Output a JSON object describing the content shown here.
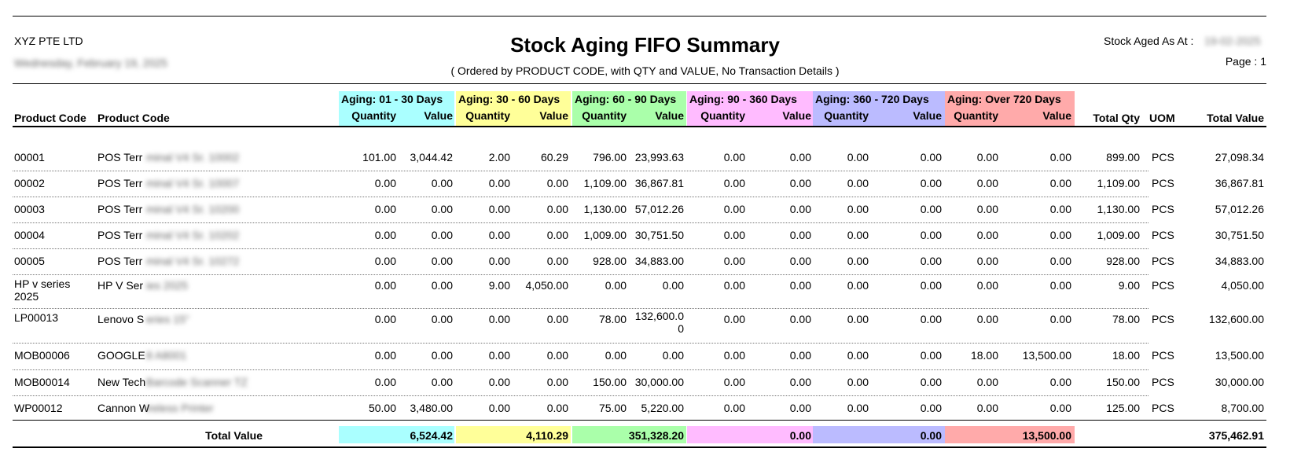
{
  "header": {
    "company": "XYZ PTE LTD",
    "date_line": "Wednesday, February 19, 2025",
    "title": "Stock Aging FIFO Summary",
    "subtitle": "( Ordered by PRODUCT CODE, with QTY and VALUE, No Transaction Details )",
    "aged_label": "Stock Aged As At :",
    "aged_value": "19-02-2025",
    "page": "Page : 1"
  },
  "columns": {
    "product_code": "Product Code",
    "product_name": "Product Code",
    "quantity": "Quantity",
    "value": "Value",
    "total_qty": "Total Qty",
    "uom": "UOM",
    "total_value": "Total Value"
  },
  "aging_bands": [
    {
      "label": "Aging:  01 - 30 Days",
      "color": "#aaffff"
    },
    {
      "label": "Aging:  30 - 60 Days",
      "color": "#ffff99"
    },
    {
      "label": "Aging:  60 - 90 Days",
      "color": "#aaffaa"
    },
    {
      "label": "Aging:  90 - 360 Days",
      "color": "#ffbbff"
    },
    {
      "label": "Aging:  360 - 720 Days",
      "color": "#bbbbff"
    },
    {
      "label": "Aging:  Over 720 Days",
      "color": "#ffaaaa"
    }
  ],
  "rows": [
    {
      "code": "00001",
      "name_visible": "POS Terr",
      "name_hidden": "minal V4 Sr. 10002",
      "vals": [
        "101.00",
        "3,044.42",
        "2.00",
        "60.29",
        "796.00",
        "23,993.63",
        "0.00",
        "0.00",
        "0.00",
        "0.00",
        "0.00",
        "0.00"
      ],
      "total_qty": "899.00",
      "uom": "PCS",
      "total_value": "27,098.34"
    },
    {
      "code": "00002",
      "name_visible": "POS Terr",
      "name_hidden": "minal V4 Sr. 10007",
      "vals": [
        "0.00",
        "0.00",
        "0.00",
        "0.00",
        "1,109.00",
        "36,867.81",
        "0.00",
        "0.00",
        "0.00",
        "0.00",
        "0.00",
        "0.00"
      ],
      "total_qty": "1,109.00",
      "uom": "PCS",
      "total_value": "36,867.81"
    },
    {
      "code": "00003",
      "name_visible": "POS Terr",
      "name_hidden": "minal V4 Sr. 10200",
      "vals": [
        "0.00",
        "0.00",
        "0.00",
        "0.00",
        "1,130.00",
        "57,012.26",
        "0.00",
        "0.00",
        "0.00",
        "0.00",
        "0.00",
        "0.00"
      ],
      "total_qty": "1,130.00",
      "uom": "PCS",
      "total_value": "57,012.26"
    },
    {
      "code": "00004",
      "name_visible": "POS Terr",
      "name_hidden": "minal V4 Sr. 10202",
      "vals": [
        "0.00",
        "0.00",
        "0.00",
        "0.00",
        "1,009.00",
        "30,751.50",
        "0.00",
        "0.00",
        "0.00",
        "0.00",
        "0.00",
        "0.00"
      ],
      "total_qty": "1,009.00",
      "uom": "PCS",
      "total_value": "30,751.50"
    },
    {
      "code": "00005",
      "name_visible": "POS Terr",
      "name_hidden": "minal V4 Sr. 10272",
      "vals": [
        "0.00",
        "0.00",
        "0.00",
        "0.00",
        "928.00",
        "34,883.00",
        "0.00",
        "0.00",
        "0.00",
        "0.00",
        "0.00",
        "0.00"
      ],
      "total_qty": "928.00",
      "uom": "PCS",
      "total_value": "34,883.00"
    },
    {
      "code": "HP v series 2025",
      "name_visible": "HP V Ser",
      "name_hidden": "ies 2025",
      "vals": [
        "0.00",
        "0.00",
        "9.00",
        "4,050.00",
        "0.00",
        "0.00",
        "0.00",
        "0.00",
        "0.00",
        "0.00",
        "0.00",
        "0.00"
      ],
      "total_qty": "9.00",
      "uom": "PCS",
      "total_value": "4,050.00"
    },
    {
      "code": "LP00013",
      "name_visible": "Lenovo S",
      "name_hidden": "eries 15\"",
      "vals": [
        "0.00",
        "0.00",
        "0.00",
        "0.00",
        "78.00",
        "132,600.00",
        "0.00",
        "0.00",
        "0.00",
        "0.00",
        "0.00",
        "0.00"
      ],
      "total_qty": "78.00",
      "uom": "PCS",
      "total_value": "132,600.00"
    },
    {
      "code": "MOB00006",
      "name_visible": "GOOGLE",
      "name_hidden": " 8 A8001",
      "vals": [
        "0.00",
        "0.00",
        "0.00",
        "0.00",
        "0.00",
        "0.00",
        "0.00",
        "0.00",
        "0.00",
        "0.00",
        "18.00",
        "13,500.00"
      ],
      "total_qty": "18.00",
      "uom": "PCS",
      "total_value": "13,500.00"
    },
    {
      "code": "MOB00014",
      "name_visible": "New Tech",
      "name_hidden": " Barcode Scanner TZ",
      "vals": [
        "0.00",
        "0.00",
        "0.00",
        "0.00",
        "150.00",
        "30,000.00",
        "0.00",
        "0.00",
        "0.00",
        "0.00",
        "0.00",
        "0.00"
      ],
      "total_qty": "150.00",
      "uom": "PCS",
      "total_value": "30,000.00"
    },
    {
      "code": "WP00012",
      "name_visible": "Cannon W",
      "name_hidden": "ireless Printer",
      "vals": [
        "50.00",
        "3,480.00",
        "0.00",
        "0.00",
        "75.00",
        "5,220.00",
        "0.00",
        "0.00",
        "0.00",
        "0.00",
        "0.00",
        "0.00"
      ],
      "total_qty": "125.00",
      "uom": "PCS",
      "total_value": "8,700.00"
    }
  ],
  "footer": {
    "label": "Total Value",
    "band_totals": [
      "6,524.42",
      "4,110.29",
      "351,328.20",
      "0.00",
      "0.00",
      "13,500.00"
    ],
    "grand_total": "375,462.91"
  }
}
